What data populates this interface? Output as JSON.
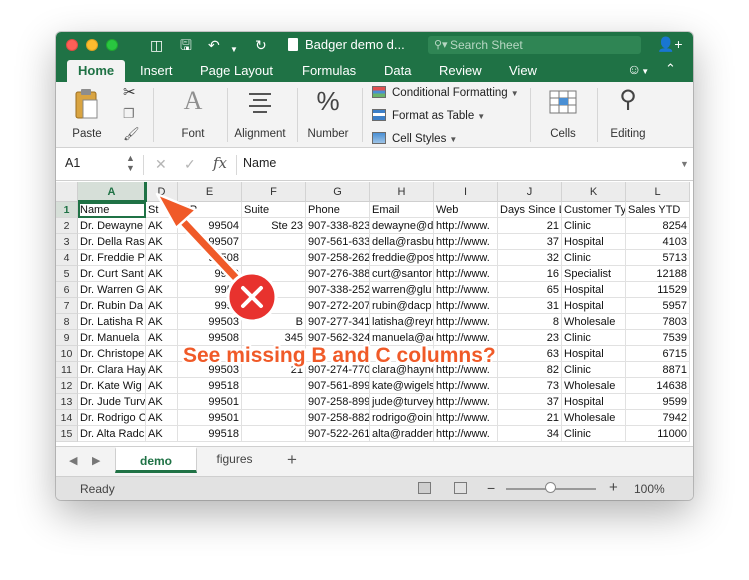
{
  "window": {
    "title": "Badger demo d...",
    "search_placeholder": "Search Sheet"
  },
  "ribbon_tabs": [
    "Home",
    "Insert",
    "Page Layout",
    "Formulas",
    "Data",
    "Review",
    "View"
  ],
  "ribbon": {
    "paste": "Paste",
    "font": "Font",
    "alignment": "Alignment",
    "number": "Number",
    "conditional_formatting": "Conditional Formatting",
    "format_as_table": "Format as Table",
    "cell_styles": "Cell Styles",
    "cells": "Cells",
    "editing": "Editing"
  },
  "formula_bar": {
    "name_box": "A1",
    "content": "Name"
  },
  "grid": {
    "columns": [
      "A",
      "D",
      "E",
      "F",
      "G",
      "H",
      "I",
      "J",
      "K",
      "L"
    ],
    "row_numbers": [
      "1",
      "2",
      "3",
      "4",
      "5",
      "6",
      "7",
      "8",
      "9",
      "10",
      "11",
      "12",
      "13",
      "14",
      "15"
    ],
    "rows": [
      [
        "Name",
        "St",
        "ZIP",
        "Suite",
        "Phone",
        "Email",
        "Web",
        "Days Since La",
        "Customer Ty",
        "Sales YTD"
      ],
      [
        "Dr. Dewayne",
        "AK",
        "99504",
        "Ste 23",
        "907-338-823",
        "dewayne@d",
        "http://www.",
        "21",
        "Clinic",
        "8254"
      ],
      [
        "Dr. Della Ras",
        "AK",
        "99507",
        "",
        "907-561-633",
        "della@rasbu",
        "http://www.",
        "37",
        "Hospital",
        "4103"
      ],
      [
        "Dr. Freddie P",
        "AK",
        "99508",
        "",
        "907-258-262",
        "freddie@pos",
        "http://www.",
        "32",
        "Clinic",
        "5713"
      ],
      [
        "Dr. Curt Sant",
        "AK",
        "9950",
        "",
        "907-276-388",
        "curt@santor",
        "http://www.",
        "16",
        "Specialist",
        "12188"
      ],
      [
        "Dr. Warren G",
        "AK",
        "9950",
        "",
        "907-338-252",
        "warren@glu",
        "http://www.",
        "65",
        "Hospital",
        "11529"
      ],
      [
        "Dr. Rubin Da",
        "AK",
        "9950",
        "",
        "907-272-207",
        "rubin@dacp",
        "http://www.",
        "31",
        "Hospital",
        "5957"
      ],
      [
        "Dr. Latisha R",
        "AK",
        "99503",
        "B",
        "907-277-341",
        "latisha@reyr",
        "http://www.",
        "8",
        "Wholesale",
        "7803"
      ],
      [
        "Dr. Manuela",
        "AK",
        "99508",
        "345",
        "907-562-324",
        "manuela@ac",
        "http://www.",
        "23",
        "Clinic",
        "7539"
      ],
      [
        "Dr. Christope",
        "AK",
        "",
        "",
        "",
        "",
        "",
        "63",
        "Hospital",
        "6715"
      ],
      [
        "Dr. Clara Hay",
        "AK",
        "99503",
        "21",
        "907-274-770",
        "clara@hayne",
        "http://www.",
        "82",
        "Clinic",
        "8871"
      ],
      [
        "Dr. Kate Wig",
        "AK",
        "99518",
        "",
        "907-561-899",
        "kate@wigels",
        "http://www.",
        "73",
        "Wholesale",
        "14638"
      ],
      [
        "Dr. Jude Turv",
        "AK",
        "99501",
        "",
        "907-258-899",
        "jude@turvey",
        "http://www.",
        "37",
        "Hospital",
        "9599"
      ],
      [
        "Dr. Rodrigo C",
        "AK",
        "99501",
        "",
        "907-258-882",
        "rodrigo@oin",
        "http://www.",
        "21",
        "Wholesale",
        "7942"
      ],
      [
        "Dr. Alta Radc",
        "AK",
        "99518",
        "",
        "907-522-261",
        "alta@radder",
        "http://www.",
        "34",
        "Clinic",
        "11000"
      ]
    ]
  },
  "sheet_tabs": [
    "demo",
    "figures"
  ],
  "status": {
    "ready": "Ready",
    "zoom": "100%",
    "zoom_level": 1.0
  },
  "annotation": {
    "text": "See missing B and C columns?",
    "color": "#f05a28"
  },
  "colors": {
    "excel_green": "#1f7245",
    "ribbon_bg": "#f3f3f3"
  }
}
